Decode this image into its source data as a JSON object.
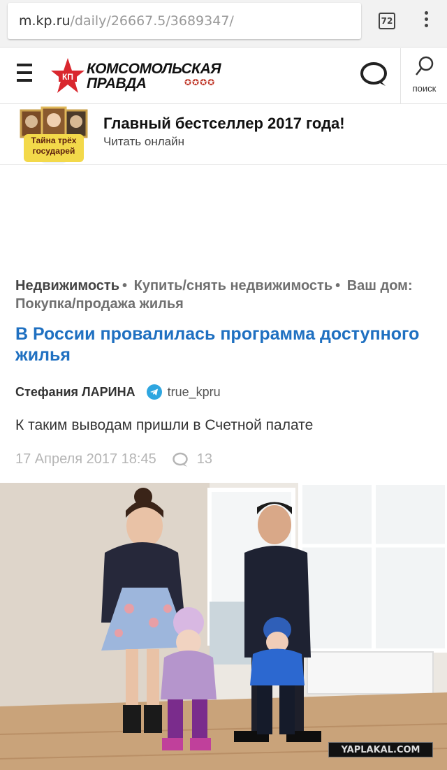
{
  "browser": {
    "url_host": "m.kp.ru",
    "url_path": "/daily/26667.5/3689347/",
    "tab_count": "72"
  },
  "header": {
    "logo_line1": "КОМСОМОЛЬСКАЯ",
    "logo_line2": "ПРАВДА",
    "logo_badge": "КП",
    "search_label": "поиск"
  },
  "promo": {
    "image_caption": "Тайна трёх государей",
    "title": "Главный бестселлер 2017 года!",
    "subtitle": "Читать онлайн"
  },
  "article": {
    "breadcrumbs": [
      "Недвижимость",
      "Купить/снять недвижимость",
      "Ваш дом: Покупка/продажа жилья"
    ],
    "headline": "В России провалилась программа доступного жилья",
    "author": "Стефания ЛАРИНА",
    "telegram_handle": "true_kpru",
    "lead": "К таким выводам пришли в Счетной палате",
    "date": "17 Апреля 2017 18:45",
    "comment_count": "13"
  },
  "photo": {
    "watermark": "YAPLAKAL.COM"
  },
  "colors": {
    "headline": "#1f70c1",
    "telegram": "#2ea6e0",
    "logo_red": "#d9272e"
  }
}
